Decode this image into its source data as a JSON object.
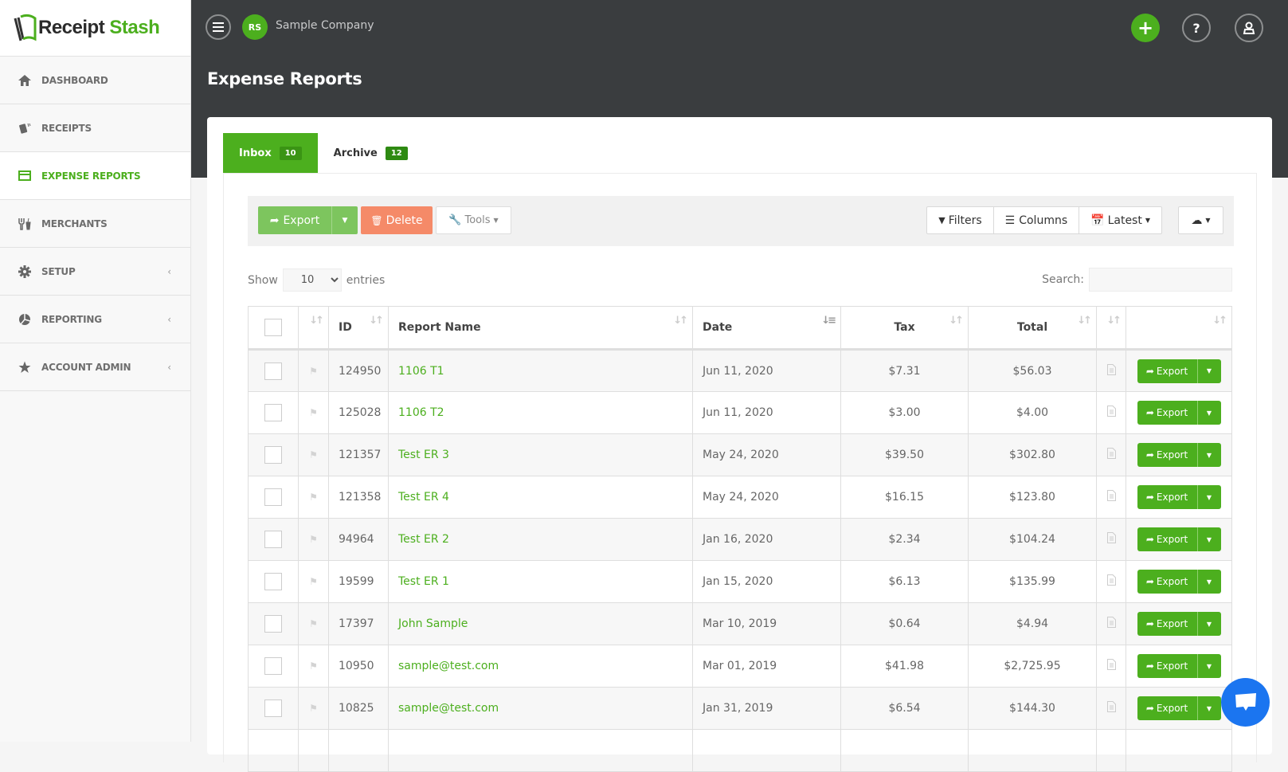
{
  "brand": {
    "name_part1": "Receipt",
    "name_part2": "Stash",
    "accent": "#4caf1e"
  },
  "sidebar": {
    "items": [
      {
        "label": "DASHBOARD",
        "icon": "home-icon",
        "active": false,
        "expandable": false
      },
      {
        "label": "RECEIPTS",
        "icon": "receipts-icon",
        "active": false,
        "expandable": false
      },
      {
        "label": "EXPENSE REPORTS",
        "icon": "credit-card-icon",
        "active": true,
        "expandable": false
      },
      {
        "label": "MERCHANTS",
        "icon": "cutlery-icon",
        "active": false,
        "expandable": false
      },
      {
        "label": "SETUP",
        "icon": "gear-icon",
        "active": false,
        "expandable": true
      },
      {
        "label": "REPORTING",
        "icon": "pie-chart-icon",
        "active": false,
        "expandable": true
      },
      {
        "label": "ACCOUNT ADMIN",
        "icon": "star-icon",
        "active": false,
        "expandable": true
      }
    ]
  },
  "header": {
    "company_logo": "RS",
    "company_name": "Sample Company",
    "page_title": "Expense Reports",
    "add_glyph": "+",
    "help_glyph": "?"
  },
  "tabs": [
    {
      "label": "Inbox",
      "count": "10",
      "active": true
    },
    {
      "label": "Archive",
      "count": "12",
      "active": false
    }
  ],
  "toolbar": {
    "export": "Export",
    "delete": "Delete",
    "tools": "Tools",
    "filters": "Filters",
    "columns": "Columns",
    "latest": "Latest"
  },
  "entries": {
    "show": "Show",
    "value": "10",
    "suffix": "entries",
    "search_label": "Search:",
    "search_value": ""
  },
  "table": {
    "headers": [
      "",
      "",
      "ID",
      "Report Name",
      "Date",
      "Tax",
      "Total",
      "",
      ""
    ],
    "rows": [
      {
        "id": "124950",
        "name": "1106 T1",
        "date": "Jun 11, 2020",
        "tax": "$7.31",
        "total": "$56.03"
      },
      {
        "id": "125028",
        "name": "1106 T2",
        "date": "Jun 11, 2020",
        "tax": "$3.00",
        "total": "$4.00"
      },
      {
        "id": "121357",
        "name": "Test ER 3",
        "date": "May 24, 2020",
        "tax": "$39.50",
        "total": "$302.80"
      },
      {
        "id": "121358",
        "name": "Test ER 4",
        "date": "May 24, 2020",
        "tax": "$16.15",
        "total": "$123.80"
      },
      {
        "id": "94964",
        "name": "Test ER 2",
        "date": "Jan 16, 2020",
        "tax": "$2.34",
        "total": "$104.24"
      },
      {
        "id": "19599",
        "name": "Test ER 1",
        "date": "Jan 15, 2020",
        "tax": "$6.13",
        "total": "$135.99"
      },
      {
        "id": "17397",
        "name": "John Sample",
        "date": "Mar 10, 2019",
        "tax": "$0.64",
        "total": "$4.94"
      },
      {
        "id": "10950",
        "name": "sample@test.com",
        "date": "Mar 01, 2019",
        "tax": "$41.98",
        "total": "$2,725.95"
      },
      {
        "id": "10825",
        "name": "sample@test.com",
        "date": "Jan 31, 2019",
        "tax": "$6.54",
        "total": "$144.30"
      },
      {
        "id": "",
        "name": "",
        "date": "",
        "tax": "",
        "total": ""
      }
    ],
    "row_action": "Export"
  }
}
